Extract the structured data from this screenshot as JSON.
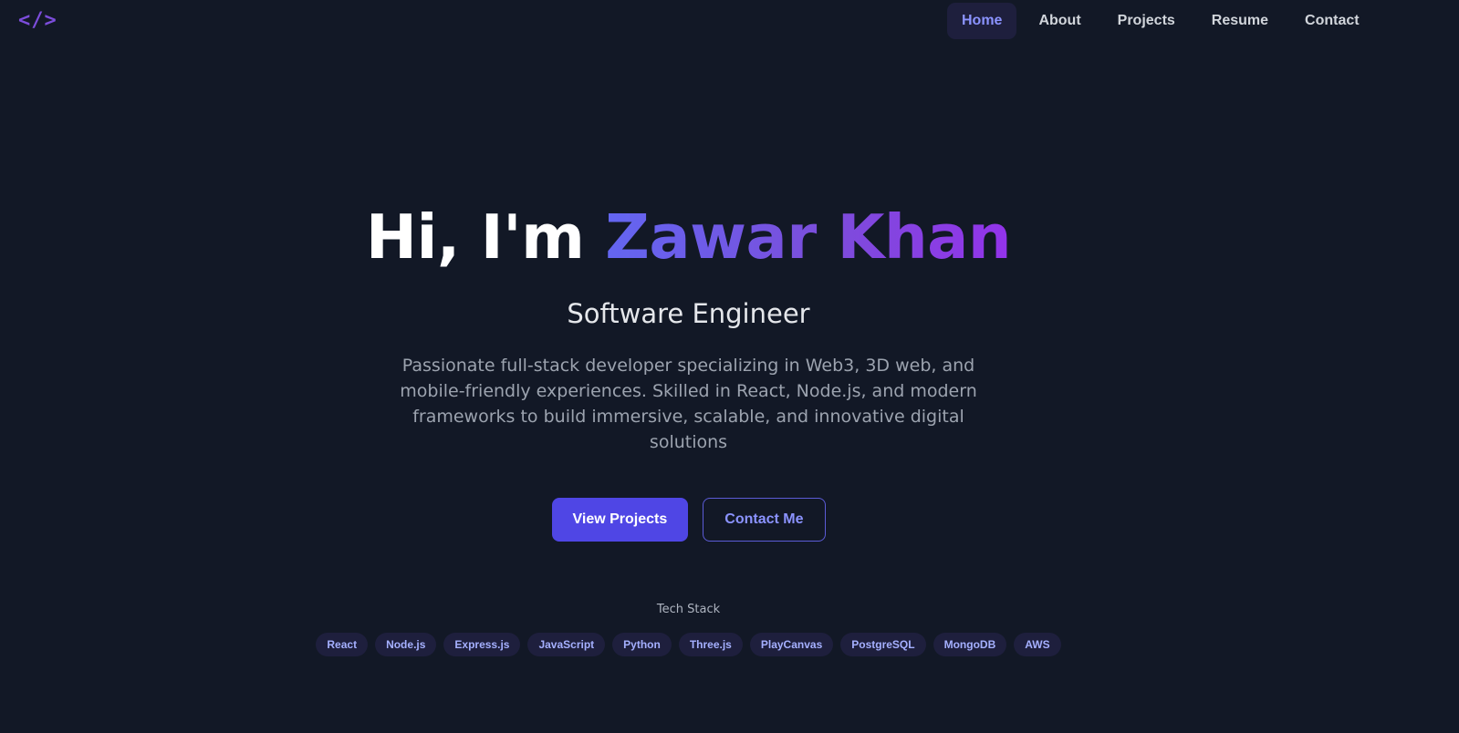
{
  "header": {
    "logo": "</>",
    "nav": [
      {
        "label": "Home",
        "active": true
      },
      {
        "label": "About",
        "active": false
      },
      {
        "label": "Projects",
        "active": false
      },
      {
        "label": "Resume",
        "active": false
      },
      {
        "label": "Contact",
        "active": false
      }
    ]
  },
  "hero": {
    "greeting": "Hi, I'm ",
    "name": "Zawar Khan",
    "role": "Software Engineer",
    "bio": "Passionate full-stack developer specializing in Web3, 3D web, and mobile-friendly experiences. Skilled in React, Node.js, and modern frameworks to build immersive, scalable, and innovative digital solutions",
    "primary_button": "View Projects",
    "secondary_button": "Contact Me"
  },
  "tech": {
    "label": "Tech Stack",
    "items": [
      "React",
      "Node.js",
      "Express.js",
      "JavaScript",
      "Python",
      "Three.js",
      "PlayCanvas",
      "PostgreSQL",
      "MongoDB",
      "AWS"
    ]
  },
  "colors": {
    "background": "#121826",
    "accent": "#4f46e5",
    "gradient_start": "#6366f1",
    "gradient_end": "#9333ea"
  }
}
